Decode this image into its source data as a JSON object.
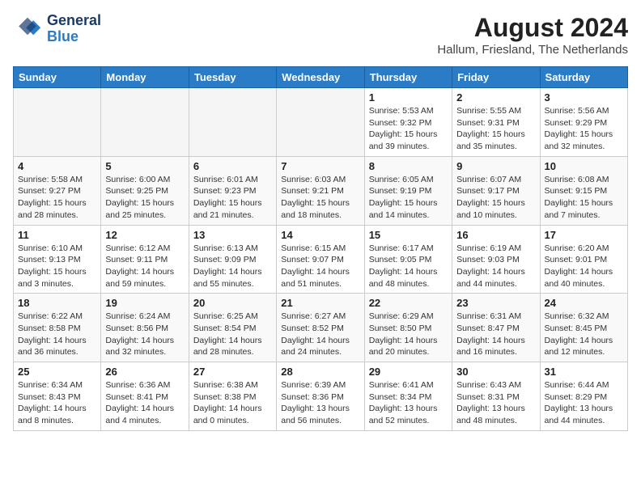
{
  "header": {
    "logo_line1": "General",
    "logo_line2": "Blue",
    "month_year": "August 2024",
    "location": "Hallum, Friesland, The Netherlands"
  },
  "weekdays": [
    "Sunday",
    "Monday",
    "Tuesday",
    "Wednesday",
    "Thursday",
    "Friday",
    "Saturday"
  ],
  "weeks": [
    [
      {
        "day": "",
        "detail": ""
      },
      {
        "day": "",
        "detail": ""
      },
      {
        "day": "",
        "detail": ""
      },
      {
        "day": "",
        "detail": ""
      },
      {
        "day": "1",
        "detail": "Sunrise: 5:53 AM\nSunset: 9:32 PM\nDaylight: 15 hours\nand 39 minutes."
      },
      {
        "day": "2",
        "detail": "Sunrise: 5:55 AM\nSunset: 9:31 PM\nDaylight: 15 hours\nand 35 minutes."
      },
      {
        "day": "3",
        "detail": "Sunrise: 5:56 AM\nSunset: 9:29 PM\nDaylight: 15 hours\nand 32 minutes."
      }
    ],
    [
      {
        "day": "4",
        "detail": "Sunrise: 5:58 AM\nSunset: 9:27 PM\nDaylight: 15 hours\nand 28 minutes."
      },
      {
        "day": "5",
        "detail": "Sunrise: 6:00 AM\nSunset: 9:25 PM\nDaylight: 15 hours\nand 25 minutes."
      },
      {
        "day": "6",
        "detail": "Sunrise: 6:01 AM\nSunset: 9:23 PM\nDaylight: 15 hours\nand 21 minutes."
      },
      {
        "day": "7",
        "detail": "Sunrise: 6:03 AM\nSunset: 9:21 PM\nDaylight: 15 hours\nand 18 minutes."
      },
      {
        "day": "8",
        "detail": "Sunrise: 6:05 AM\nSunset: 9:19 PM\nDaylight: 15 hours\nand 14 minutes."
      },
      {
        "day": "9",
        "detail": "Sunrise: 6:07 AM\nSunset: 9:17 PM\nDaylight: 15 hours\nand 10 minutes."
      },
      {
        "day": "10",
        "detail": "Sunrise: 6:08 AM\nSunset: 9:15 PM\nDaylight: 15 hours\nand 7 minutes."
      }
    ],
    [
      {
        "day": "11",
        "detail": "Sunrise: 6:10 AM\nSunset: 9:13 PM\nDaylight: 15 hours\nand 3 minutes."
      },
      {
        "day": "12",
        "detail": "Sunrise: 6:12 AM\nSunset: 9:11 PM\nDaylight: 14 hours\nand 59 minutes."
      },
      {
        "day": "13",
        "detail": "Sunrise: 6:13 AM\nSunset: 9:09 PM\nDaylight: 14 hours\nand 55 minutes."
      },
      {
        "day": "14",
        "detail": "Sunrise: 6:15 AM\nSunset: 9:07 PM\nDaylight: 14 hours\nand 51 minutes."
      },
      {
        "day": "15",
        "detail": "Sunrise: 6:17 AM\nSunset: 9:05 PM\nDaylight: 14 hours\nand 48 minutes."
      },
      {
        "day": "16",
        "detail": "Sunrise: 6:19 AM\nSunset: 9:03 PM\nDaylight: 14 hours\nand 44 minutes."
      },
      {
        "day": "17",
        "detail": "Sunrise: 6:20 AM\nSunset: 9:01 PM\nDaylight: 14 hours\nand 40 minutes."
      }
    ],
    [
      {
        "day": "18",
        "detail": "Sunrise: 6:22 AM\nSunset: 8:58 PM\nDaylight: 14 hours\nand 36 minutes."
      },
      {
        "day": "19",
        "detail": "Sunrise: 6:24 AM\nSunset: 8:56 PM\nDaylight: 14 hours\nand 32 minutes."
      },
      {
        "day": "20",
        "detail": "Sunrise: 6:25 AM\nSunset: 8:54 PM\nDaylight: 14 hours\nand 28 minutes."
      },
      {
        "day": "21",
        "detail": "Sunrise: 6:27 AM\nSunset: 8:52 PM\nDaylight: 14 hours\nand 24 minutes."
      },
      {
        "day": "22",
        "detail": "Sunrise: 6:29 AM\nSunset: 8:50 PM\nDaylight: 14 hours\nand 20 minutes."
      },
      {
        "day": "23",
        "detail": "Sunrise: 6:31 AM\nSunset: 8:47 PM\nDaylight: 14 hours\nand 16 minutes."
      },
      {
        "day": "24",
        "detail": "Sunrise: 6:32 AM\nSunset: 8:45 PM\nDaylight: 14 hours\nand 12 minutes."
      }
    ],
    [
      {
        "day": "25",
        "detail": "Sunrise: 6:34 AM\nSunset: 8:43 PM\nDaylight: 14 hours\nand 8 minutes."
      },
      {
        "day": "26",
        "detail": "Sunrise: 6:36 AM\nSunset: 8:41 PM\nDaylight: 14 hours\nand 4 minutes."
      },
      {
        "day": "27",
        "detail": "Sunrise: 6:38 AM\nSunset: 8:38 PM\nDaylight: 14 hours\nand 0 minutes."
      },
      {
        "day": "28",
        "detail": "Sunrise: 6:39 AM\nSunset: 8:36 PM\nDaylight: 13 hours\nand 56 minutes."
      },
      {
        "day": "29",
        "detail": "Sunrise: 6:41 AM\nSunset: 8:34 PM\nDaylight: 13 hours\nand 52 minutes."
      },
      {
        "day": "30",
        "detail": "Sunrise: 6:43 AM\nSunset: 8:31 PM\nDaylight: 13 hours\nand 48 minutes."
      },
      {
        "day": "31",
        "detail": "Sunrise: 6:44 AM\nSunset: 8:29 PM\nDaylight: 13 hours\nand 44 minutes."
      }
    ]
  ]
}
